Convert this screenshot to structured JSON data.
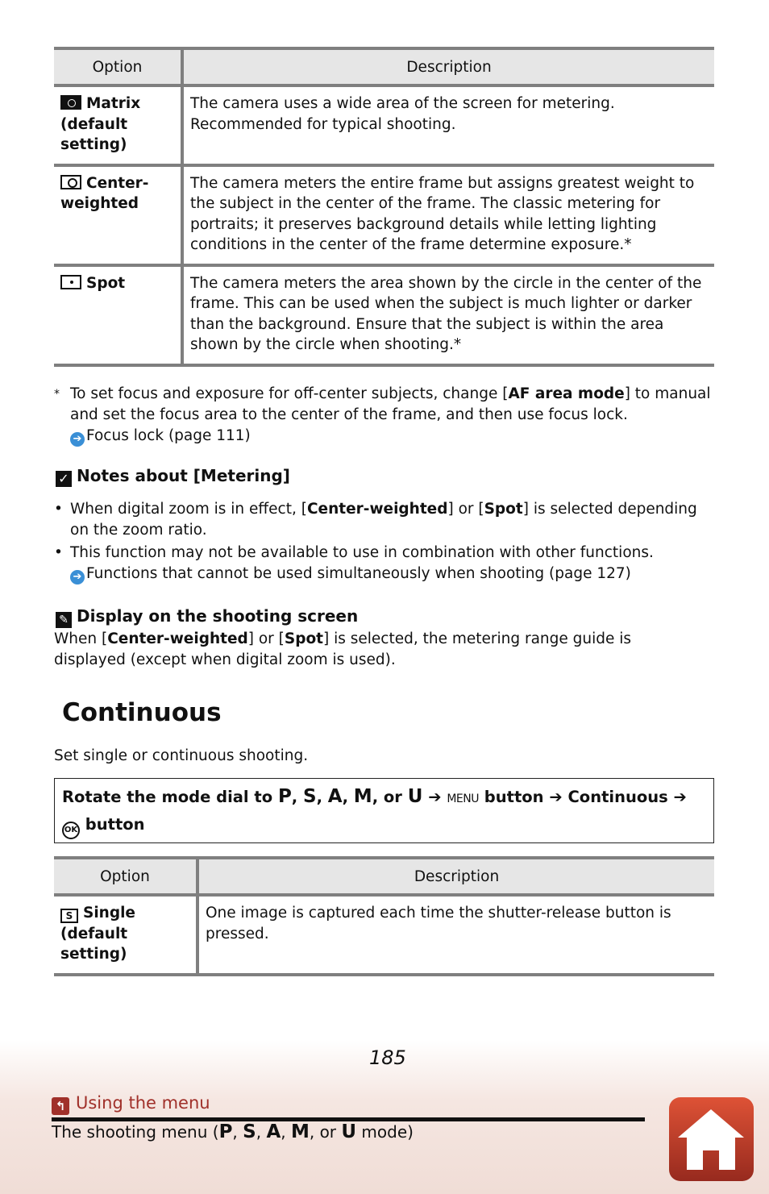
{
  "metering_table": {
    "headers": [
      "Option",
      "Description"
    ],
    "rows": [
      {
        "icon": "matrix-metering-icon",
        "option_line1": "Matrix",
        "option_line2": "(default",
        "option_line3": "setting)",
        "description": "The camera uses a wide area of the screen for metering. Recommended for typical shooting."
      },
      {
        "icon": "center-weighted-metering-icon",
        "option_line1": "Center-",
        "option_line2": "weighted",
        "description": "The camera meters the entire frame but assigns greatest weight to the subject in the center of the frame. The classic metering for portraits; it preserves background details while letting lighting conditions in the center of the frame determine exposure.*"
      },
      {
        "icon": "spot-metering-icon",
        "option_line1": "Spot",
        "description": "The camera meters the area shown by the circle in the center of the frame. This can be used when the subject is much lighter or darker than the background. Ensure that the subject is within the area shown by the circle when shooting.*"
      }
    ]
  },
  "footnote": {
    "marker": "*",
    "text_before": "To set focus and exposure for off-center subjects, change [",
    "bold": "AF area mode",
    "text_after": "] to manual and set the focus area to the center of the frame, and then use focus lock.",
    "link": "Focus lock (page 111)"
  },
  "notes": {
    "title": "Notes about [Metering]",
    "bullet1_before": "When digital zoom is in effect, [",
    "bullet1_bold1": "Center-weighted",
    "bullet1_mid": "] or [",
    "bullet1_bold2": "Spot",
    "bullet1_after": "] is selected depending on the zoom ratio.",
    "bullet2": "This function may not be available to use in combination with other functions.",
    "link": "Functions that cannot be used simultaneously when shooting (page 127)"
  },
  "display": {
    "title": "Display on the shooting screen",
    "text_before": "When [",
    "bold1": "Center-weighted",
    "mid": "] or [",
    "bold2": "Spot",
    "text_after": "] is selected, the metering range guide is displayed (except when digital zoom is used)."
  },
  "continuous": {
    "heading": "Continuous",
    "intro": "Set single or continuous shooting.",
    "procedure": {
      "prefix": "Rotate the mode dial to",
      "modes": [
        "P",
        "S",
        "A",
        "M"
      ],
      "or": "or",
      "last_mode": "U",
      "arrow": "➔",
      "menu": "MENU",
      "button_word": "button",
      "menu_item": "Continuous",
      "ok": "OK",
      "final": "button"
    }
  },
  "continuous_table": {
    "headers": [
      "Option",
      "Description"
    ],
    "rows": [
      {
        "icon": "single-frame-icon",
        "icon_letter": "S",
        "option_line1": "Single",
        "option_line2": "(default setting)",
        "description": "One image is captured each time the shutter-release button is pressed."
      }
    ]
  },
  "footer": {
    "page_number": "185",
    "back_link": "Using the menu",
    "breadcrumb_before": "The shooting menu (",
    "breadcrumb_modes": [
      "P",
      "S",
      "A",
      "M"
    ],
    "breadcrumb_or": ", or ",
    "breadcrumb_last": "U",
    "breadcrumb_after": " mode)",
    "home_button": "home"
  },
  "colors": {
    "accent_red": "#a0302a",
    "link_blue": "#3a8fd6",
    "table_rule": "#7f7f7f",
    "header_fill": "#e6e6e6"
  }
}
